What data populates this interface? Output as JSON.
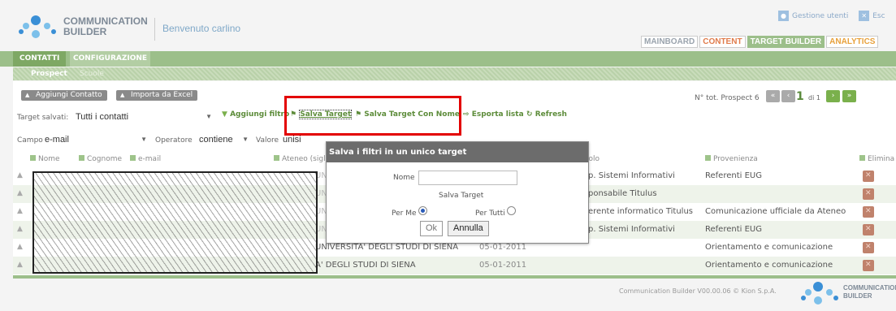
{
  "brand": {
    "name_line1": "COMMUNICATION",
    "name_line2": "BUILDER"
  },
  "welcome": "Benvenuto carlino",
  "top_links": {
    "users": "Gestione utenti",
    "exit": "Esc"
  },
  "main_tabs": [
    "MAINBOARD",
    "CONTENT",
    "TARGET BUILDER",
    "ANALYTICS"
  ],
  "tabs": [
    "CONTATTI",
    "CONFIGURAZIONE"
  ],
  "subtabs": [
    "Prospect",
    "Scuole"
  ],
  "toolbar": {
    "add_contact": "Aggiungi Contatto",
    "import_excel": "Importa da Excel"
  },
  "pager": {
    "total_label": "N° tot. Prospect 6",
    "page": "1",
    "of": "di 1"
  },
  "target": {
    "label": "Target salvati:",
    "value": "Tutti i contatti",
    "add_filter": "Aggiungi filtro",
    "save_target": "Salva Target",
    "save_named": "Salva Target Con Nome",
    "export": "Esporta lista",
    "refresh": "Refresh"
  },
  "filter": {
    "field_label": "Campo",
    "field_value": "e-mail",
    "op_label": "Operatore",
    "op_value": "contiene",
    "val_label": "Valore",
    "val_value": "unisi"
  },
  "columns": [
    "Nome",
    "Cognome",
    "e-mail",
    "Ateneo (sigla)",
    "Ruolo",
    "Provenienza",
    "Elimina"
  ],
  "rows": [
    {
      "ateneo": "UNIVERSITA'",
      "ruolo": "p. Sistemi Informativi",
      "prov": "Referenti EUG",
      "date": ""
    },
    {
      "ateneo": "UNIVERSITA'",
      "ruolo": "ponsabile Titulus",
      "prov": "",
      "date": ""
    },
    {
      "ateneo": "UNIVERSITA'",
      "ruolo": "erente informatico Titulus",
      "prov": "Comunicazione ufficiale da Ateneo",
      "date": ""
    },
    {
      "ateneo": "UNIVERSITA'",
      "ruolo": "p. Sistemi Informativi",
      "prov": "Referenti EUG",
      "date": ""
    },
    {
      "ateneo": "UNIVERSITA' DEGLI STUDI DI SIENA",
      "ruolo": "",
      "prov": "Orientamento e comunicazione",
      "date": "05-01-2011"
    },
    {
      "ateneo": "A' DEGLI STUDI DI SIENA",
      "ruolo": "",
      "prov": "Orientamento e comunicazione",
      "date": "05-01-2011"
    }
  ],
  "dialog": {
    "title": "Salva i filtri in un unico target",
    "name_label": "Nome",
    "name_value": "",
    "section": "Salva Target",
    "per_me": "Per Me",
    "per_tutti": "Per Tutti",
    "ok": "Ok",
    "cancel": "Annulla"
  },
  "footer": "Communication Builder V00.00.06 © Kion S.p.A.",
  "colors": {
    "green": "#9cbf8a",
    "accent_red": "#e30000",
    "dialog_title": "#6c6c6c"
  }
}
